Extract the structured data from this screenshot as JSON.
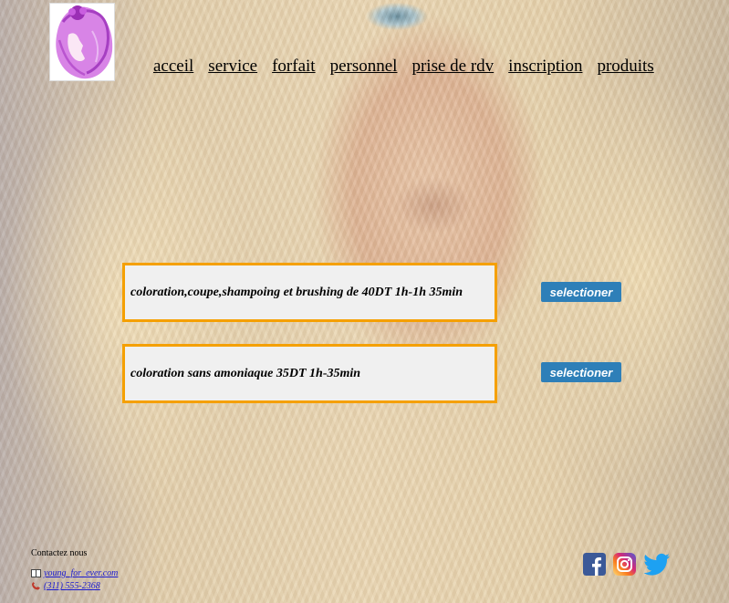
{
  "nav": {
    "items": [
      {
        "label": "acceil"
      },
      {
        "label": "service"
      },
      {
        "label": "forfait"
      },
      {
        "label": "personnel"
      },
      {
        "label": "prise de rdv"
      },
      {
        "label": "inscription"
      },
      {
        "label": "produits"
      }
    ]
  },
  "offers": [
    {
      "text": "coloration,coupe,shampoing et brushing de 40DT 1h-1h 35min",
      "button": "selectioner"
    },
    {
      "text": "coloration sans amoniaque 35DT 1h-35min",
      "button": "selectioner"
    }
  ],
  "contact": {
    "title": "Contactez nous",
    "email": "young_for_ever.com",
    "phone": "(311) 555-2368"
  },
  "social": {
    "icons": [
      "facebook-icon",
      "instagram-icon",
      "twitter-icon"
    ],
    "colors": {
      "facebook": "#3b5998",
      "twitter": "#1da1f2"
    }
  },
  "colors": {
    "offer_border": "#f5a000",
    "button": "#2e7fb8",
    "logo_accent": "#c45ad6"
  }
}
